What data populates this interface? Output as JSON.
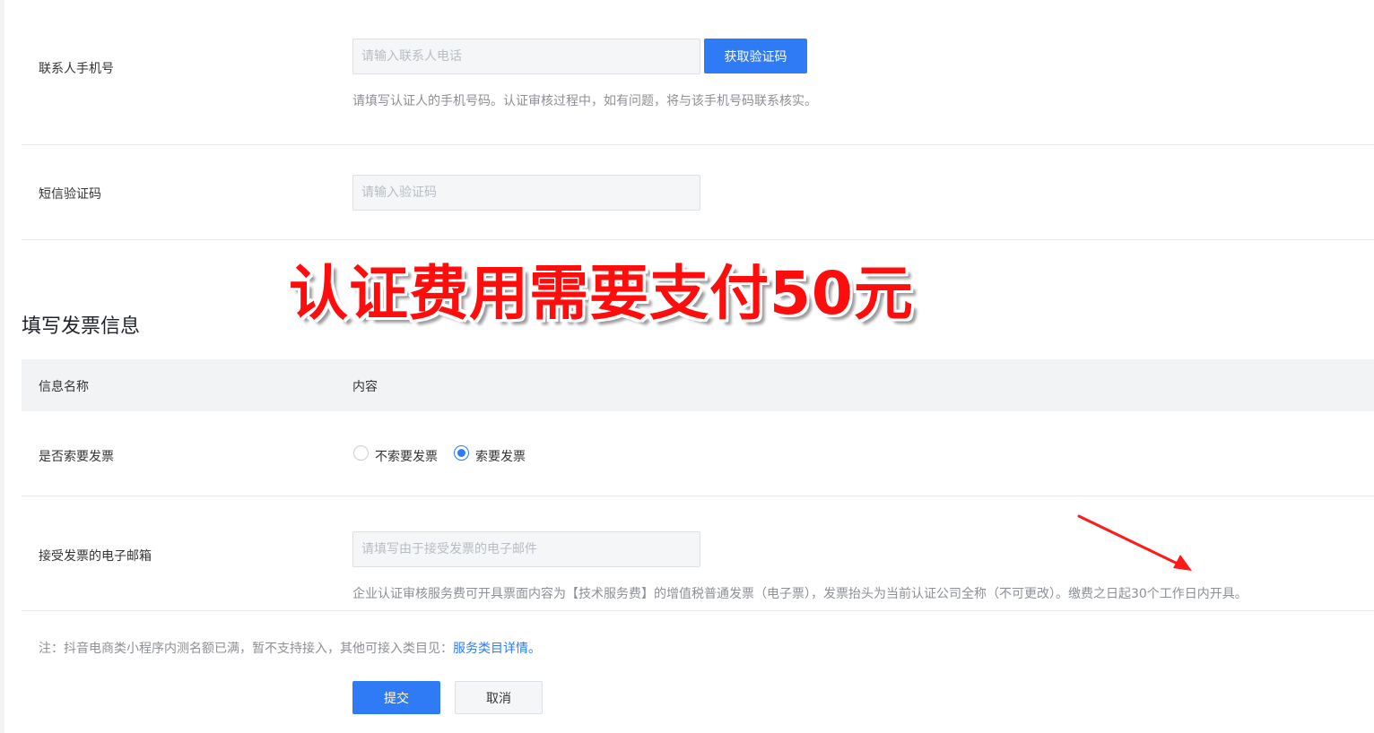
{
  "phone_row": {
    "label": "联系人手机号",
    "placeholder": "请输入联系人电话",
    "button": "获取验证码",
    "hint": "请填写认证人的手机号码。认证审核过程中，如有问题，将与该手机号码联系核实。"
  },
  "sms_row": {
    "label": "短信验证码",
    "placeholder": "请输入验证码"
  },
  "annotation": {
    "overlay_text": "认证费用需要支付50元",
    "accent_color": "#ff0d0d"
  },
  "invoice_section": {
    "title": "填写发票信息",
    "columns": [
      "信息名称",
      "内容"
    ],
    "request_row": {
      "label": "是否索要发票",
      "options": [
        "不索要发票",
        "索要发票"
      ],
      "selected": "索要发票"
    },
    "email_row": {
      "label": "接受发票的电子邮箱",
      "placeholder": "请填写由于接受发票的电子邮件",
      "hint": "企业认证审核服务费可开具票面内容为【技术服务费】的增值税普通发票（电子票），发票抬头为当前认证公司全称（不可更改）。缴费之日起30个工作日内开具。"
    }
  },
  "note": {
    "text": "注：抖音电商类小程序内测名额已满，暂不支持接入，其他可接入类目见：",
    "link": "服务类目详情。"
  },
  "actions": {
    "submit": "提交",
    "cancel": "取消"
  },
  "colors": {
    "primary": "#2f7bf5",
    "divider": "#e5e6eb",
    "header_bg": "#f2f3f5"
  }
}
